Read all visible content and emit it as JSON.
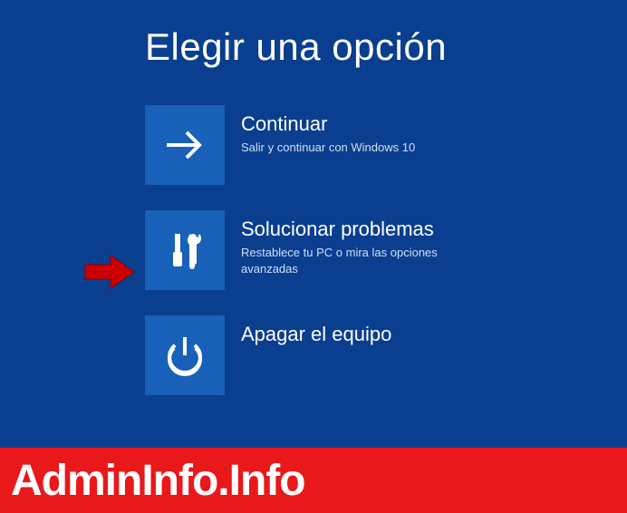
{
  "title": "Elegir una opción",
  "options": [
    {
      "title": "Continuar",
      "desc": "Salir y continuar con Windows 10"
    },
    {
      "title": "Solucionar problemas",
      "desc": "Restablece tu PC o mira las opciones avanzadas"
    },
    {
      "title": "Apagar el equipo",
      "desc": ""
    }
  ],
  "watermark": "AdminInfo.Info"
}
